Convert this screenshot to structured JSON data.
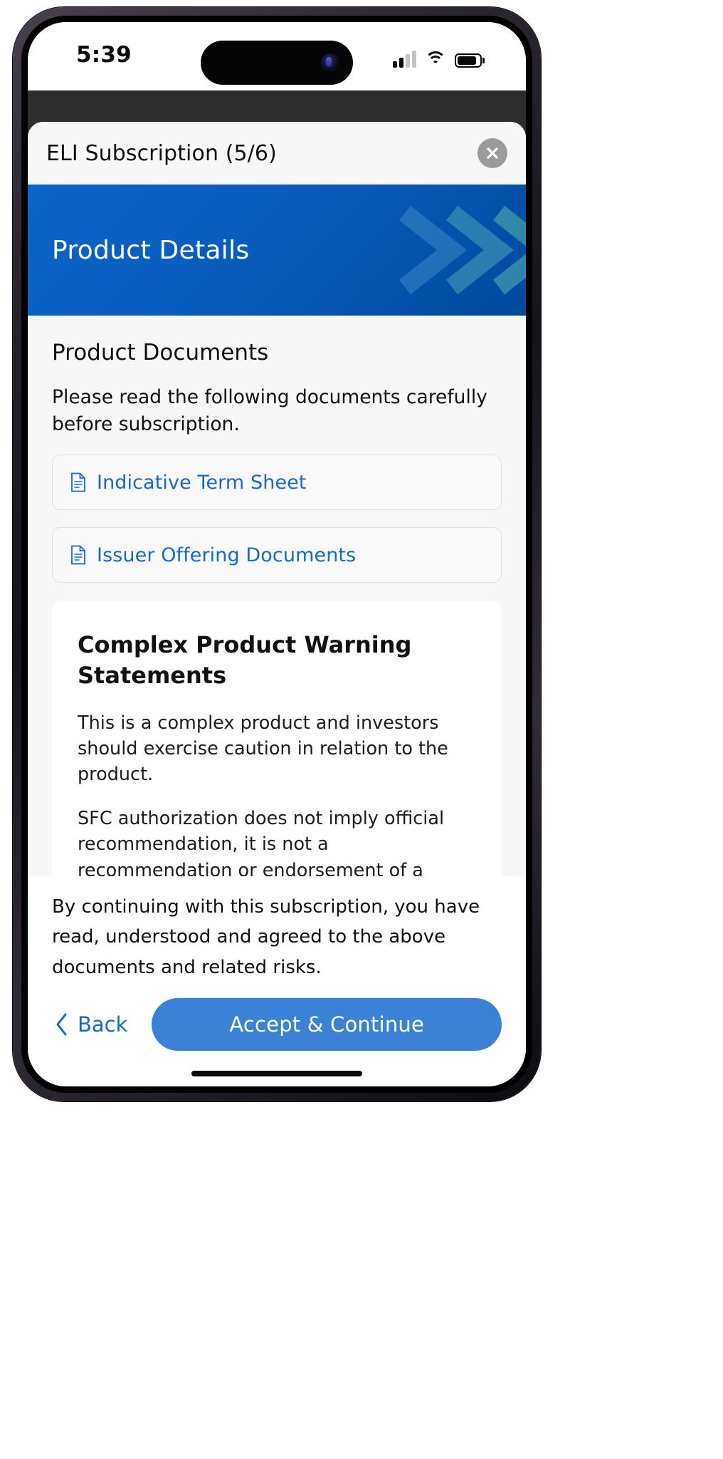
{
  "status_bar": {
    "time": "5:39",
    "signal_icon": "cellular-signal-icon",
    "wifi_icon": "wifi-icon",
    "battery_icon": "battery-icon"
  },
  "sheet": {
    "title": "ELI Subscription (5/6)",
    "close_icon": "close-icon"
  },
  "hero": {
    "title": "Product Details",
    "gradient_start": "#0b64c8",
    "gradient_end": "#004a9e"
  },
  "main": {
    "section_title": "Product Documents",
    "section_description": "Please read the following documents carefully before subscription.",
    "documents": [
      {
        "label": "Indicative Term Sheet",
        "icon": "document-icon"
      },
      {
        "label": "Issuer Offering Documents",
        "icon": "document-icon"
      }
    ],
    "warning_card": {
      "title": "Complex Product Warning Statements",
      "paragraphs": [
        "This is a complex product and investors should exercise caution in relation to the product.",
        "SFC authorization does not imply official recommendation, it is not a recommendation or endorsement of a product, nor does it guarantee the commercial merits of a product or its performance."
      ]
    }
  },
  "footer": {
    "consent_text": "By continuing with this subscription, you have read, understood and agreed to the above documents and related risks.",
    "back_label": "Back",
    "back_icon": "chevron-left-icon",
    "accept_label": "Accept & Continue",
    "accent_color": "#1868c8",
    "accept_button_color": "#3b82d6"
  }
}
